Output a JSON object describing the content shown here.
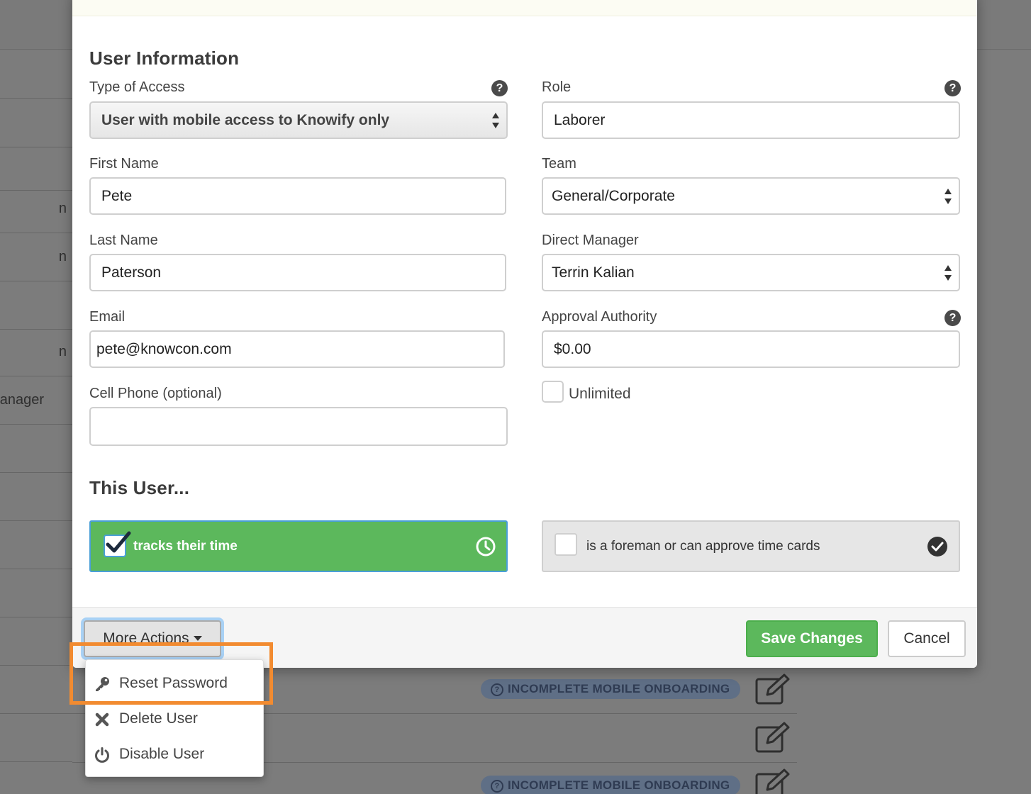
{
  "background": {
    "row_labels": [
      "n",
      "n",
      "n",
      "anager"
    ],
    "badge_label": "INCOMPLETE MOBILE ONBOARDING"
  },
  "modal": {
    "section_user_info": "User Information",
    "type_of_access": {
      "label": "Type of Access",
      "value": "User with mobile access to Knowify only"
    },
    "role": {
      "label": "Role",
      "value": "Laborer"
    },
    "first_name": {
      "label": "First Name",
      "value": "Pete"
    },
    "team": {
      "label": "Team",
      "value": "General/Corporate"
    },
    "last_name": {
      "label": "Last Name",
      "value": "Paterson"
    },
    "direct_manager": {
      "label": "Direct Manager",
      "value": "Terrin Kalian"
    },
    "email": {
      "label": "Email",
      "value": "pete@knowcon.com"
    },
    "approval_authority": {
      "label": "Approval Authority",
      "value": "$0.00"
    },
    "cell_phone": {
      "label": "Cell Phone (optional)",
      "value": ""
    },
    "unlimited": {
      "label": "Unlimited",
      "checked": false
    },
    "section_this_user": "This User...",
    "tracks_time": {
      "label": "tracks their time",
      "checked": true
    },
    "foreman": {
      "label": "is a foreman or can approve time cards",
      "checked": false
    },
    "help_icon": "?"
  },
  "footer": {
    "more_actions": "More Actions",
    "save": "Save Changes",
    "cancel": "Cancel"
  },
  "dropdown": {
    "items": [
      {
        "label": "Reset Password",
        "icon": "key-icon"
      },
      {
        "label": "Delete User",
        "icon": "close-icon"
      },
      {
        "label": "Disable User",
        "icon": "power-icon"
      }
    ]
  },
  "colors": {
    "accent_green": "#5cb85c",
    "highlight_orange": "#f28b30",
    "focus_blue": "#a8d1f5"
  }
}
